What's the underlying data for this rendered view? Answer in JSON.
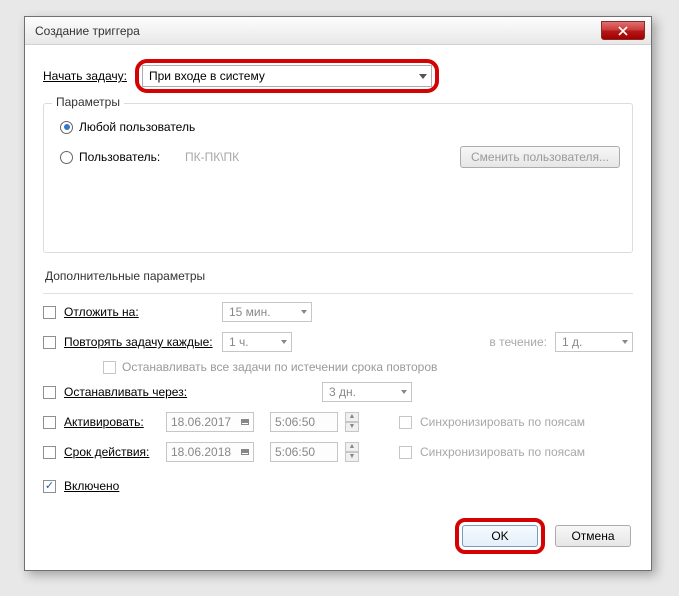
{
  "window": {
    "title": "Создание триггера"
  },
  "start": {
    "label": "Начать задачу:",
    "value": "При входе в систему"
  },
  "settings": {
    "group_title": "Параметры",
    "any_user": "Любой пользователь",
    "user": "Пользователь:",
    "user_value": "ПК-ПК\\ПК",
    "change_user": "Сменить пользователя..."
  },
  "adv": {
    "title": "Дополнительные параметры",
    "delay": "Отложить на:",
    "delay_val": "15 мин.",
    "repeat": "Повторять задачу каждые:",
    "repeat_val": "1 ч.",
    "for": "в течение:",
    "for_val": "1 д.",
    "stop_all": "Останавливать все задачи по истечении срока повторов",
    "stop_after": "Останавливать через:",
    "stop_after_val": "3 дн.",
    "activate": "Активировать:",
    "act_date": "18.06.2017",
    "act_time": "5:06:50",
    "expire": "Срок действия:",
    "exp_date": "18.06.2018",
    "exp_time": "5:06:50",
    "sync": "Синхронизировать по поясам",
    "enabled": "Включено"
  },
  "buttons": {
    "ok": "OK",
    "cancel": "Отмена"
  }
}
